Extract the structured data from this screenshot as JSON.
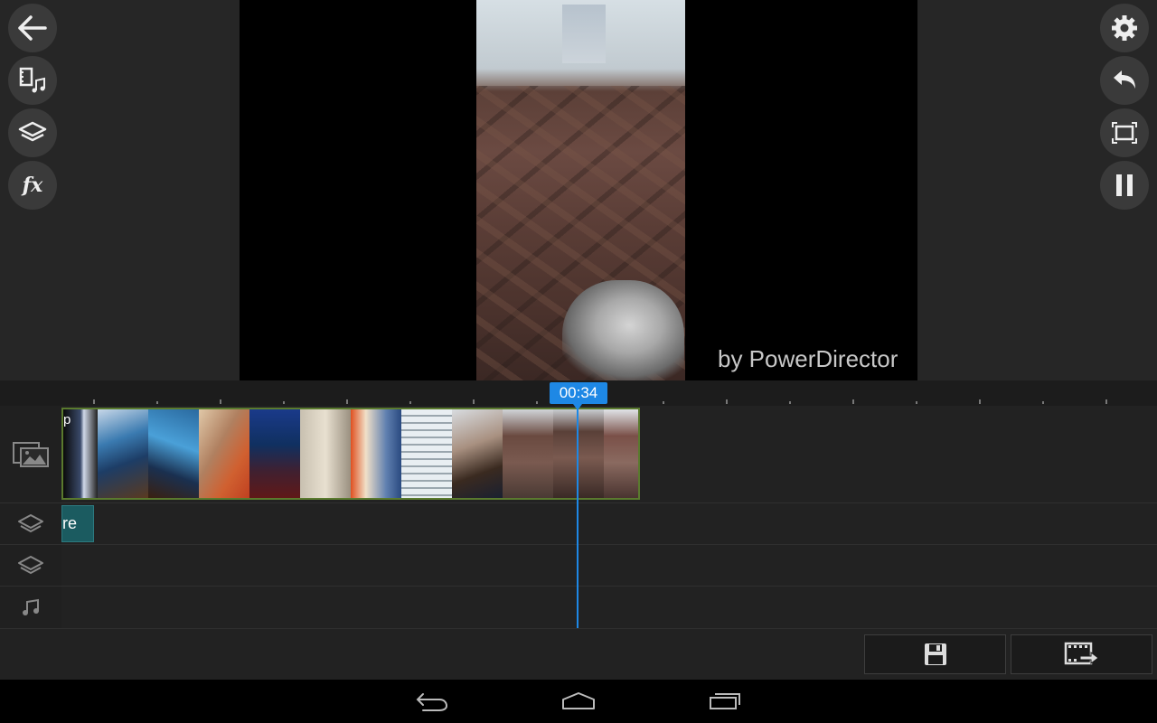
{
  "preview": {
    "watermark": "by PowerDirector"
  },
  "left_toolbar": [
    {
      "name": "back-button",
      "icon": "back-arrow-icon"
    },
    {
      "name": "media-library-button",
      "icon": "film-music-icon"
    },
    {
      "name": "layers-button",
      "icon": "layers-icon"
    },
    {
      "name": "effects-button",
      "icon": "fx-icon",
      "label": "fx"
    }
  ],
  "right_toolbar": [
    {
      "name": "settings-button",
      "icon": "gear-icon"
    },
    {
      "name": "undo-button",
      "icon": "undo-icon"
    },
    {
      "name": "fullscreen-button",
      "icon": "fullscreen-icon"
    },
    {
      "name": "pause-button",
      "icon": "pause-icon"
    }
  ],
  "timeline": {
    "playhead_time": "00:34",
    "video_track": {
      "icon": "video-image-track-icon",
      "clip_label": "p"
    },
    "overlay_track_1": {
      "icon": "layers-track-icon",
      "clip_label": "re"
    },
    "overlay_track_2": {
      "icon": "layers-track-icon"
    },
    "audio_track": {
      "icon": "music-note-icon"
    }
  },
  "bottom_toolbar": [
    {
      "name": "save-project-button",
      "icon": "save-icon"
    },
    {
      "name": "produce-video-button",
      "icon": "film-export-icon"
    }
  ],
  "system_nav": [
    {
      "name": "nav-back-button",
      "icon": "back-icon"
    },
    {
      "name": "nav-home-button",
      "icon": "home-icon"
    },
    {
      "name": "nav-recents-button",
      "icon": "recents-icon"
    }
  ],
  "colors": {
    "accent": "#1e88e5",
    "clip_border": "#5a7a2e",
    "overlay_clip": "#1b5b60"
  }
}
